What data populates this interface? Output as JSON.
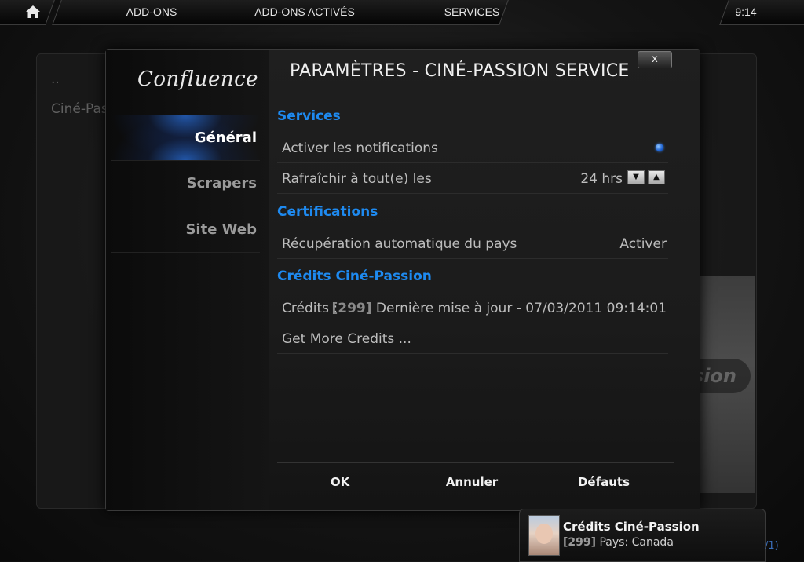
{
  "topbar": {
    "home_icon": "home-icon",
    "crumb1": "ADD-ONS",
    "crumb2": "ADD-ONS ACTIVÉS",
    "crumb3": "SERVICES",
    "time": "9:14"
  },
  "background": {
    "parent_item": "..",
    "selected_item": "Ciné-Passion Service",
    "art_logo": "Ciné-Passion"
  },
  "dialog": {
    "logo": "Confluence",
    "title": "PARAMÈTRES - CINÉ-PASSION SERVICE",
    "close_label": "x",
    "categories": [
      {
        "label": "Général",
        "active": true
      },
      {
        "label": "Scrapers",
        "active": false
      },
      {
        "label": "Site Web",
        "active": false
      }
    ],
    "sections": {
      "services": "Services",
      "certifications": "Certifications",
      "credits": "Crédits Ciné-Passion"
    },
    "settings": {
      "notifications_label": "Activer les notifications",
      "refresh_label": "Rafraîchir à tout(e) les",
      "refresh_value": "24 hrs",
      "auto_country_label": "Récupération automatique du pays",
      "auto_country_value": "Activer",
      "credits_label": "Crédits :",
      "credits_count": "[299]",
      "credits_text": "Dernière mise à jour - 07/03/2011 09:14:01",
      "more_credits": "Get More Credits ..."
    },
    "buttons": {
      "ok": "OK",
      "cancel": "Annuler",
      "defaults": "Défauts"
    }
  },
  "notification": {
    "title": "Crédits Ciné-Passion",
    "count": "[299]",
    "body": "Pays: Canada"
  },
  "page_counter": "/1)",
  "colors": {
    "accent_blue": "#1e8af0",
    "highlight_blue": "#286edc"
  }
}
